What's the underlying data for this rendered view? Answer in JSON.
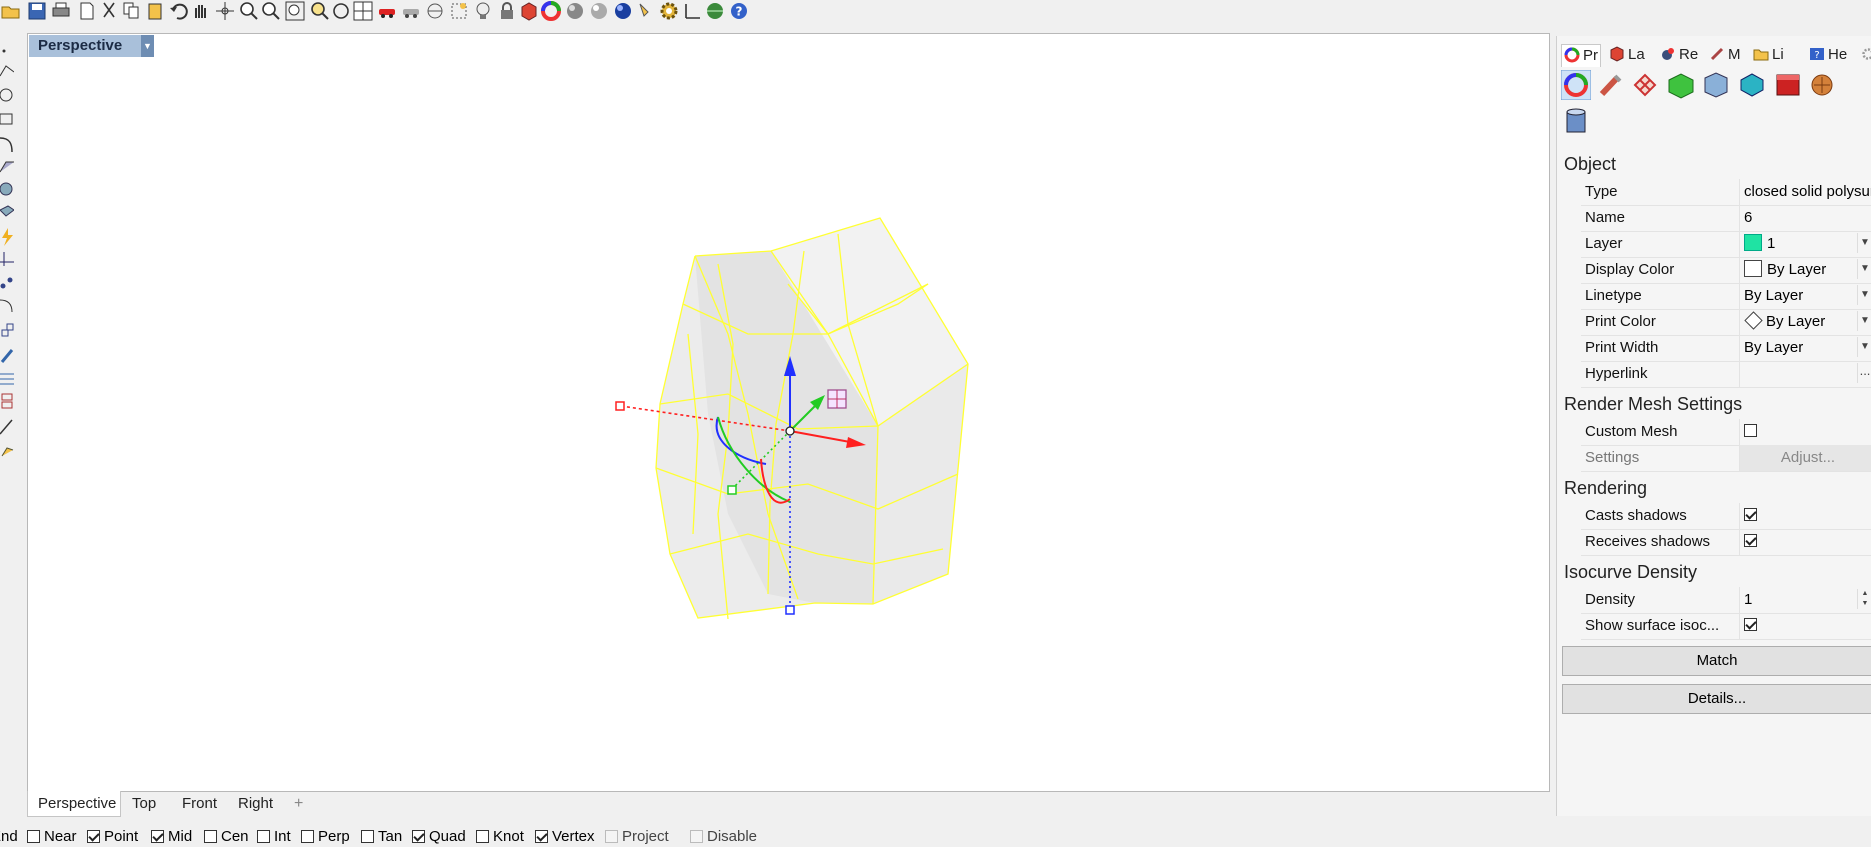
{
  "viewport": {
    "title": "Perspective",
    "tabs": [
      "Perspective",
      "Top",
      "Front",
      "Right"
    ],
    "add_tab_glyph": "+"
  },
  "osnap": {
    "items": [
      {
        "label": "End",
        "checked": true
      },
      {
        "label": "Near",
        "checked": false
      },
      {
        "label": "Point",
        "checked": true
      },
      {
        "label": "Mid",
        "checked": true
      },
      {
        "label": "Cen",
        "checked": false
      },
      {
        "label": "Int",
        "checked": false
      },
      {
        "label": "Perp",
        "checked": false
      },
      {
        "label": "Tan",
        "checked": false
      },
      {
        "label": "Quad",
        "checked": true
      },
      {
        "label": "Knot",
        "checked": false
      },
      {
        "label": "Vertex",
        "checked": true
      },
      {
        "label": "Project",
        "checked": false
      },
      {
        "label": "Disable",
        "checked": false
      }
    ]
  },
  "panel": {
    "tabs": [
      {
        "label": "Pr",
        "icon": "properties-color-wheel-icon"
      },
      {
        "label": "La",
        "icon": "layers-icon"
      },
      {
        "label": "Re",
        "icon": "render-icon"
      },
      {
        "label": "M",
        "icon": "materials-icon"
      },
      {
        "label": "Li",
        "icon": "libraries-folder-icon"
      },
      {
        "label": "He",
        "icon": "help-icon"
      }
    ],
    "object_section": "Object",
    "object_rows": [
      {
        "label": "Type",
        "value": "closed solid polysurf..."
      },
      {
        "label": "Name",
        "value": "6"
      },
      {
        "label": "Layer",
        "value": "1"
      },
      {
        "label": "Display Color",
        "value": "By Layer"
      },
      {
        "label": "Linetype",
        "value": "By Layer"
      },
      {
        "label": "Print Color",
        "value": "By Layer"
      },
      {
        "label": "Print Width",
        "value": "By Layer"
      },
      {
        "label": "Hyperlink",
        "value": ""
      }
    ],
    "hyperlink_button": "...",
    "mesh_section": "Render Mesh Settings",
    "custom_mesh_label": "Custom Mesh",
    "custom_mesh_checked": false,
    "settings_label": "Settings",
    "adjust_label": "Adjust...",
    "rendering_section": "Rendering",
    "casts_shadows_label": "Casts shadows",
    "casts_shadows_checked": true,
    "receives_shadows_label": "Receives shadows",
    "receives_shadows_checked": true,
    "isocurve_section": "Isocurve Density",
    "density_label": "Density",
    "density_value": "1",
    "show_isocurves_label": "Show surface isoc...",
    "show_isocurves_checked": true,
    "match_label": "Match",
    "details_label": "Details..."
  },
  "colors": {
    "layer_swatch": "#1fe3a3",
    "viewport_title_bg": "#a9c0da",
    "object_wire": "#ffff33",
    "gumball_x": "#ff2020",
    "gumball_y": "#22cc22",
    "gumball_z": "#2030ff"
  }
}
